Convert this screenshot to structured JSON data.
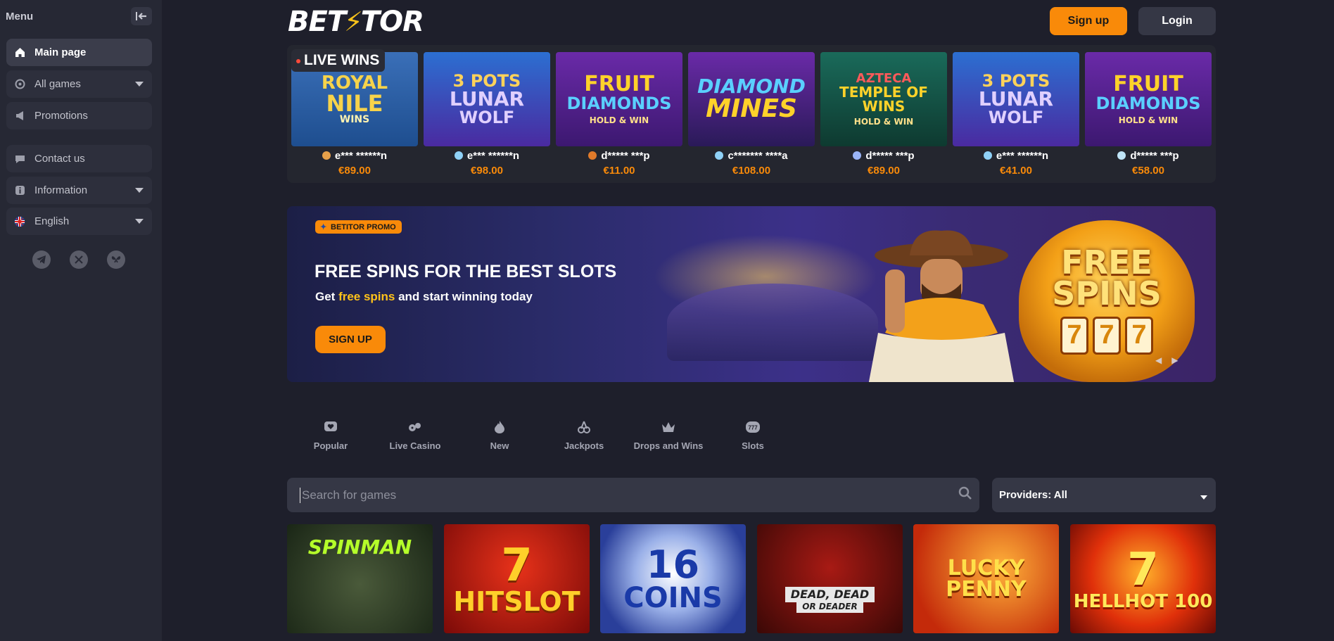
{
  "sidebar": {
    "title": "Menu",
    "items": [
      {
        "label": "Main page",
        "icon": "home-icon"
      },
      {
        "label": "All games",
        "icon": "games-icon"
      },
      {
        "label": "Promotions",
        "icon": "megaphone-icon"
      },
      {
        "label": "Contact us",
        "icon": "chat-icon"
      },
      {
        "label": "Information",
        "icon": "info-icon"
      },
      {
        "label": "English",
        "icon": "uk-flag-icon"
      }
    ],
    "socials": [
      "telegram-icon",
      "x-icon",
      "butterfly-icon"
    ]
  },
  "header": {
    "logo_left": "BET",
    "logo_right": "TOR",
    "signup": "Sign up",
    "login": "Login"
  },
  "live_wins": {
    "label": "LIVE WINS",
    "items": [
      {
        "game_line1": "ROYAL",
        "game_line2": "NILE",
        "game_line3": "WINS",
        "user": "e*** ******n",
        "amount": "€89.00"
      },
      {
        "game_line1": "3 POTS",
        "game_line2": "LUNAR",
        "game_line3": "WOLF",
        "user": "e*** ******n",
        "amount": "€98.00"
      },
      {
        "game_line1": "FRUIT",
        "game_line2": "DIAMONDS",
        "game_line3": "HOLD & WIN",
        "user": "d***** ***p",
        "amount": "€11.00"
      },
      {
        "game_line1": "DIAMOND",
        "game_line2": "MINES",
        "game_line3": "",
        "user": "c******* ****a",
        "amount": "€108.00"
      },
      {
        "game_line1": "AZTECA",
        "game_line2": "TEMPLE OF WINS",
        "game_line3": "HOLD & WIN",
        "user": "d***** ***p",
        "amount": "€89.00"
      },
      {
        "game_line1": "3 POTS",
        "game_line2": "LUNAR",
        "game_line3": "WOLF",
        "user": "e*** ******n",
        "amount": "€41.00"
      },
      {
        "game_line1": "FRUIT",
        "game_line2": "DIAMONDS",
        "game_line3": "HOLD & WIN",
        "user": "d***** ***p",
        "amount": "€58.00"
      }
    ]
  },
  "promo": {
    "tag": "BETITOR PROMO",
    "title": "FREE SPINS FOR THE BEST SLOTS",
    "sub_before": "Get ",
    "sub_highlight": "free spins",
    "sub_after": " and start winning today",
    "button": "SIGN UP",
    "badge_line1": "FREE",
    "badge_line2": "SPINS",
    "reels": [
      "7",
      "7",
      "7"
    ]
  },
  "categories": [
    {
      "label": "Popular",
      "icon": "heart-icon"
    },
    {
      "label": "Live Casino",
      "icon": "live-casino-icon"
    },
    {
      "label": "New",
      "icon": "flame-icon"
    },
    {
      "label": "Jackpots",
      "icon": "cherries-icon"
    },
    {
      "label": "Drops and Wins",
      "icon": "crown-icon"
    },
    {
      "label": "Slots",
      "icon": "slot-777-icon"
    }
  ],
  "search": {
    "placeholder": "Search for games"
  },
  "providers": {
    "label": "Providers: All"
  },
  "games": [
    {
      "line1": "SPINMAN",
      "line2": ""
    },
    {
      "line1": "7",
      "line2": "HITSLOT"
    },
    {
      "line1": "16",
      "line2": "COINS"
    },
    {
      "line1": "DEAD, DEAD",
      "line2": "OR DEADER"
    },
    {
      "line1": "LUCKY",
      "line2": "PENNY"
    },
    {
      "line1": "7",
      "line2": "HELLHOT 100"
    }
  ],
  "colors": {
    "accent": "#f98a09",
    "highlight": "#ffc21a",
    "background": "#1e1f2b",
    "sidebar": "#262834"
  }
}
